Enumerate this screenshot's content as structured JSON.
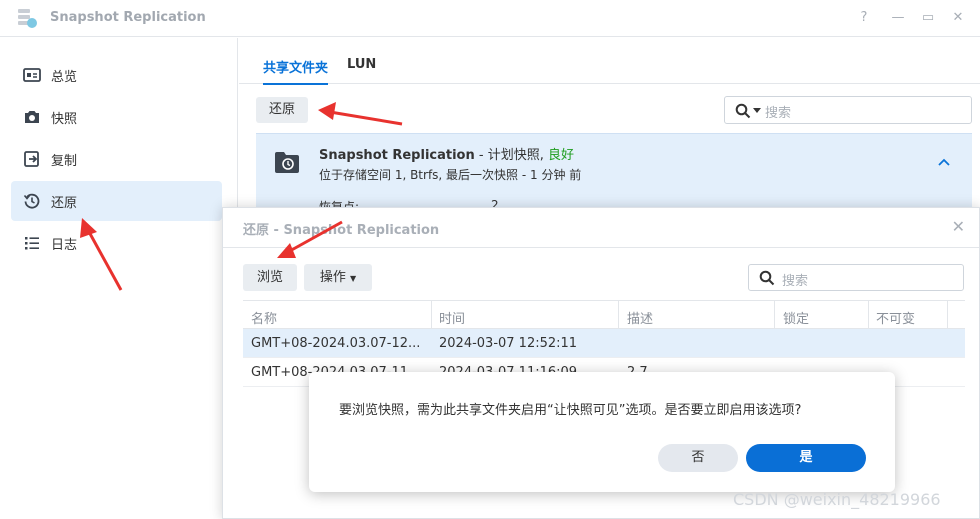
{
  "window": {
    "title": "Snapshot Replication",
    "controls": [
      "?",
      "—",
      "▭",
      "✕"
    ]
  },
  "sidebar": {
    "items": [
      {
        "label": "总览",
        "icon": "overview-icon"
      },
      {
        "label": "快照",
        "icon": "camera-icon"
      },
      {
        "label": "复制",
        "icon": "replicate-icon"
      },
      {
        "label": "还原",
        "icon": "restore-icon"
      },
      {
        "label": "日志",
        "icon": "log-list-icon"
      }
    ],
    "active_index": 3
  },
  "main": {
    "tabs": [
      {
        "label": "共享文件夹"
      },
      {
        "label": "LUN"
      }
    ],
    "restore_button": "还原",
    "search_placeholder": "搜索",
    "panel": {
      "title": "Snapshot Replication",
      "title_suffix": "- 计划快照,",
      "status": "良好",
      "subtitle": "位于存储空间 1, Btrfs, 最后一次快照 - 1 分钟 前",
      "restore_points_label": "恢复点:",
      "restore_points_value": "2"
    }
  },
  "dialog": {
    "title": "还原 - Snapshot Replication",
    "browse_button": "浏览",
    "actions_button": "操作",
    "search_placeholder": "搜索",
    "columns": [
      "名称",
      "时间",
      "描述",
      "锁定",
      "不可变"
    ],
    "rows": [
      {
        "name": "GMT+08-2024.03.07-12...",
        "time": "2024-03-07 12:52:11",
        "desc": "",
        "lock": "",
        "immutable": ""
      },
      {
        "name": "GMT+08-2024.03.07-11...",
        "time": "2024-03-07 11:16:09",
        "desc": "2.7",
        "lock": "",
        "immutable": ""
      }
    ]
  },
  "confirm": {
    "message": "要浏览快照，需为此共享文件夹启用“让快照可见”选项。是否要立即启用该选项?",
    "no_label": "否",
    "yes_label": "是"
  },
  "watermark": "CSDN @weixin_48219966",
  "colors": {
    "accent": "#0a73d8",
    "status_good": "#1f9d1f",
    "selected_bg": "#e3effb",
    "annotation_arrow": "#e8322e"
  }
}
